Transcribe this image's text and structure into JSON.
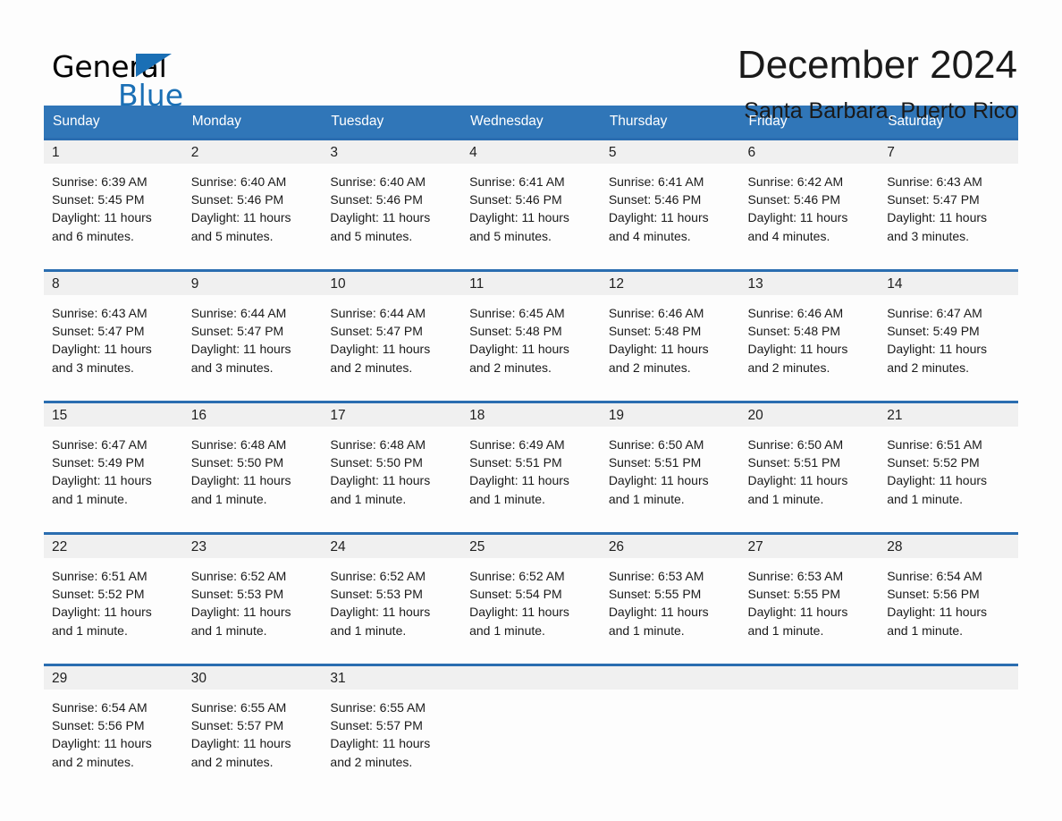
{
  "brand": {
    "name_part1": "General",
    "name_part2": "Blue",
    "triangle_color": "#1a6fb5"
  },
  "header": {
    "month_title": "December 2024",
    "location": "Santa Barbara, Puerto Rico"
  },
  "theme": {
    "header_blue": "#3076b8",
    "rule_blue": "#2a6db0",
    "date_bar_gray": "#f0f0f0",
    "page_background": "#fdfdfd"
  },
  "weekdays": [
    "Sunday",
    "Monday",
    "Tuesday",
    "Wednesday",
    "Thursday",
    "Friday",
    "Saturday"
  ],
  "weeks": [
    [
      {
        "day": "1",
        "info": "Sunrise: 6:39 AM\nSunset: 5:45 PM\nDaylight: 11 hours\nand 6 minutes."
      },
      {
        "day": "2",
        "info": "Sunrise: 6:40 AM\nSunset: 5:46 PM\nDaylight: 11 hours\nand 5 minutes."
      },
      {
        "day": "3",
        "info": "Sunrise: 6:40 AM\nSunset: 5:46 PM\nDaylight: 11 hours\nand 5 minutes."
      },
      {
        "day": "4",
        "info": "Sunrise: 6:41 AM\nSunset: 5:46 PM\nDaylight: 11 hours\nand 5 minutes."
      },
      {
        "day": "5",
        "info": "Sunrise: 6:41 AM\nSunset: 5:46 PM\nDaylight: 11 hours\nand 4 minutes."
      },
      {
        "day": "6",
        "info": "Sunrise: 6:42 AM\nSunset: 5:46 PM\nDaylight: 11 hours\nand 4 minutes."
      },
      {
        "day": "7",
        "info": "Sunrise: 6:43 AM\nSunset: 5:47 PM\nDaylight: 11 hours\nand 3 minutes."
      }
    ],
    [
      {
        "day": "8",
        "info": "Sunrise: 6:43 AM\nSunset: 5:47 PM\nDaylight: 11 hours\nand 3 minutes."
      },
      {
        "day": "9",
        "info": "Sunrise: 6:44 AM\nSunset: 5:47 PM\nDaylight: 11 hours\nand 3 minutes."
      },
      {
        "day": "10",
        "info": "Sunrise: 6:44 AM\nSunset: 5:47 PM\nDaylight: 11 hours\nand 2 minutes."
      },
      {
        "day": "11",
        "info": "Sunrise: 6:45 AM\nSunset: 5:48 PM\nDaylight: 11 hours\nand 2 minutes."
      },
      {
        "day": "12",
        "info": "Sunrise: 6:46 AM\nSunset: 5:48 PM\nDaylight: 11 hours\nand 2 minutes."
      },
      {
        "day": "13",
        "info": "Sunrise: 6:46 AM\nSunset: 5:48 PM\nDaylight: 11 hours\nand 2 minutes."
      },
      {
        "day": "14",
        "info": "Sunrise: 6:47 AM\nSunset: 5:49 PM\nDaylight: 11 hours\nand 2 minutes."
      }
    ],
    [
      {
        "day": "15",
        "info": "Sunrise: 6:47 AM\nSunset: 5:49 PM\nDaylight: 11 hours\nand 1 minute."
      },
      {
        "day": "16",
        "info": "Sunrise: 6:48 AM\nSunset: 5:50 PM\nDaylight: 11 hours\nand 1 minute."
      },
      {
        "day": "17",
        "info": "Sunrise: 6:48 AM\nSunset: 5:50 PM\nDaylight: 11 hours\nand 1 minute."
      },
      {
        "day": "18",
        "info": "Sunrise: 6:49 AM\nSunset: 5:51 PM\nDaylight: 11 hours\nand 1 minute."
      },
      {
        "day": "19",
        "info": "Sunrise: 6:50 AM\nSunset: 5:51 PM\nDaylight: 11 hours\nand 1 minute."
      },
      {
        "day": "20",
        "info": "Sunrise: 6:50 AM\nSunset: 5:51 PM\nDaylight: 11 hours\nand 1 minute."
      },
      {
        "day": "21",
        "info": "Sunrise: 6:51 AM\nSunset: 5:52 PM\nDaylight: 11 hours\nand 1 minute."
      }
    ],
    [
      {
        "day": "22",
        "info": "Sunrise: 6:51 AM\nSunset: 5:52 PM\nDaylight: 11 hours\nand 1 minute."
      },
      {
        "day": "23",
        "info": "Sunrise: 6:52 AM\nSunset: 5:53 PM\nDaylight: 11 hours\nand 1 minute."
      },
      {
        "day": "24",
        "info": "Sunrise: 6:52 AM\nSunset: 5:53 PM\nDaylight: 11 hours\nand 1 minute."
      },
      {
        "day": "25",
        "info": "Sunrise: 6:52 AM\nSunset: 5:54 PM\nDaylight: 11 hours\nand 1 minute."
      },
      {
        "day": "26",
        "info": "Sunrise: 6:53 AM\nSunset: 5:55 PM\nDaylight: 11 hours\nand 1 minute."
      },
      {
        "day": "27",
        "info": "Sunrise: 6:53 AM\nSunset: 5:55 PM\nDaylight: 11 hours\nand 1 minute."
      },
      {
        "day": "28",
        "info": "Sunrise: 6:54 AM\nSunset: 5:56 PM\nDaylight: 11 hours\nand 1 minute."
      }
    ],
    [
      {
        "day": "29",
        "info": "Sunrise: 6:54 AM\nSunset: 5:56 PM\nDaylight: 11 hours\nand 2 minutes."
      },
      {
        "day": "30",
        "info": "Sunrise: 6:55 AM\nSunset: 5:57 PM\nDaylight: 11 hours\nand 2 minutes."
      },
      {
        "day": "31",
        "info": "Sunrise: 6:55 AM\nSunset: 5:57 PM\nDaylight: 11 hours\nand 2 minutes."
      },
      {
        "day": "",
        "info": ""
      },
      {
        "day": "",
        "info": ""
      },
      {
        "day": "",
        "info": ""
      },
      {
        "day": "",
        "info": ""
      }
    ]
  ]
}
